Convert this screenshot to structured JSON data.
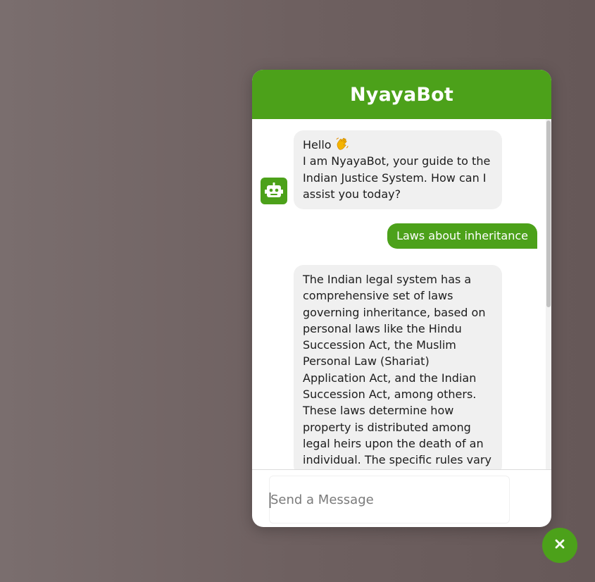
{
  "header": {
    "title": "NyayaBot"
  },
  "messages": [
    {
      "role": "bot",
      "greeting": "Hello",
      "emoji_icon": "waving-hand-icon",
      "text": "I am NyayaBot, your guide to the Indian Justice System. How can I assist you today?"
    },
    {
      "role": "user",
      "text": "Laws about inheritance"
    },
    {
      "role": "bot",
      "text": "The Indian legal system has a comprehensive set of laws governing inheritance, based on personal laws like the Hindu Succession Act, the Muslim Personal Law (Shariat) Application Act, and the Indian Succession Act, among others. These laws determine how property is distributed among legal heirs upon the death of an individual. The specific rules vary"
    }
  ],
  "input": {
    "placeholder": "Send a Message",
    "value": ""
  },
  "icons": {
    "avatar": "robot-icon",
    "close": "close-icon"
  },
  "colors": {
    "accent": "#4ca11a",
    "bot_bubble": "#f0f0f0",
    "user_text": "#ffffff"
  }
}
